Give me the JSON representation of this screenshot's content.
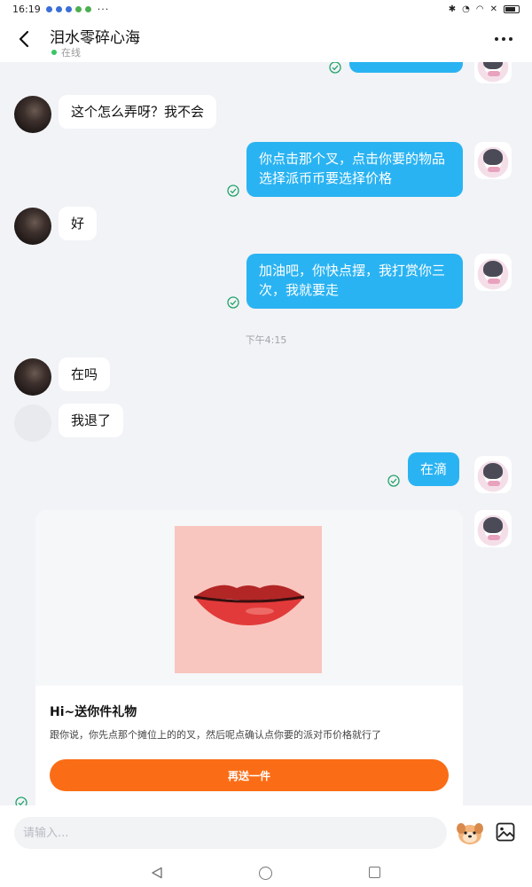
{
  "status_bar": {
    "time": "16:19",
    "more": "···"
  },
  "header": {
    "title": "泪水零碎心海",
    "status": "在线"
  },
  "messages": [
    {
      "side": "left",
      "text": "这个怎么弄呀？我不会"
    },
    {
      "side": "right",
      "text": "你点击那个叉，点击你要的物品选择派币币要选择价格"
    },
    {
      "side": "left",
      "text": "好"
    },
    {
      "side": "right",
      "text": "加油吧，你快点摆，我打赏你三次，我就要走"
    },
    {
      "side": "left",
      "text": "在吗"
    },
    {
      "side": "left",
      "text": "我退了"
    },
    {
      "side": "right",
      "text": "在滴"
    }
  ],
  "timestamp": "下午4:15",
  "gift_card": {
    "title": "Hi~送你件礼物",
    "description": "跟你说，你先点那个摊位上的的叉，然后呢点确认点你要的派对币价格就行了",
    "button_label": "再送一件"
  },
  "input": {
    "placeholder": "请输入..."
  },
  "colors": {
    "outgoing_bubble": "#2ab3f2",
    "incoming_bubble": "#ffffff",
    "gift_button": "#fa6d16",
    "online_dot": "#3ac569",
    "read_check": "#21a36b"
  }
}
